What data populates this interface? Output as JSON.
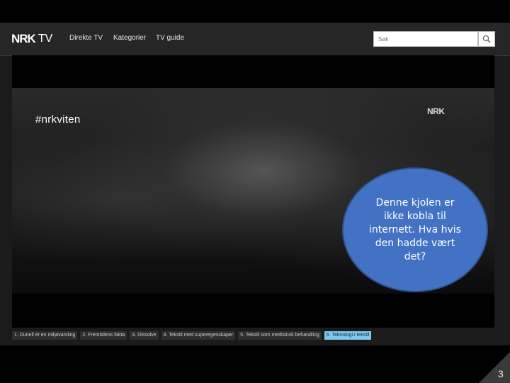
{
  "navbar": {
    "logo_mark": "NRK",
    "logo_tv": "TV",
    "links": [
      "Direkte TV",
      "Kategorier",
      "TV guide"
    ],
    "search": {
      "placeholder": "Søk",
      "value": ""
    }
  },
  "video": {
    "hashtag": "#nrkviten",
    "bug": "NRK"
  },
  "callout": {
    "text": "Denne kjolen er ikke kobla til internett. Hva hvis den hadde vært det?"
  },
  "chapters": [
    "1. Dunell er en miljøvarsling",
    "2. Fremtidens fakta",
    "3. Dissolve",
    "4. Tekstil med superegenskaper",
    "5. Tekstil som medisinsk behandling",
    "6. Teknologi i tekstil"
  ],
  "active_chapter_index": 5,
  "slide": {
    "page_number": "3"
  },
  "colors": {
    "callout_fill": "#4372c4",
    "callout_border": "#2f528f",
    "active_chapter": "#7fc8ee"
  },
  "icons": {
    "search_button": "search-icon"
  }
}
